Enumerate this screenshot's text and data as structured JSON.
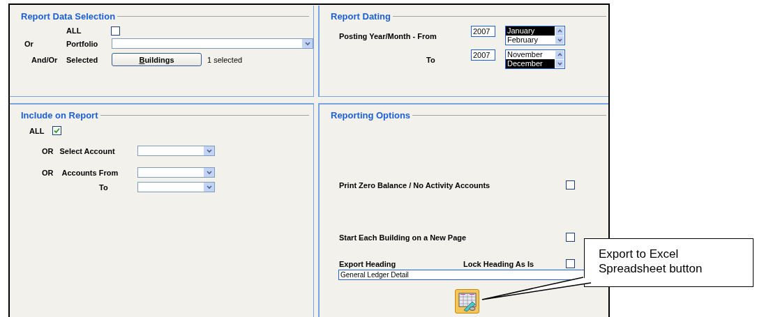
{
  "report_data_selection": {
    "title": "Report Data Selection",
    "all": {
      "label": "ALL",
      "checked": false
    },
    "portfolio": {
      "prefix": "Or",
      "label": "Portfolio"
    },
    "selected": {
      "prefix": "And/Or",
      "label": "Selected",
      "button": "**B**uildings",
      "status": "1 selected"
    }
  },
  "report_dating": {
    "title": "Report Dating",
    "rows": [
      {
        "label": "Posting Year/Month - From",
        "year": "2007",
        "months": [
          {
            "label": "January",
            "selected": true
          },
          {
            "label": "February",
            "selected": false
          }
        ]
      },
      {
        "label": "To",
        "year": "2007",
        "months": [
          {
            "label": "November",
            "selected": false
          },
          {
            "label": "December",
            "selected": true
          }
        ]
      }
    ]
  },
  "include_on_report": {
    "title": "Include on Report",
    "all": {
      "label": "ALL",
      "checked": true
    },
    "rows": [
      {
        "prefix": "OR",
        "label": "Select Account"
      },
      {
        "prefix": "OR",
        "label": "Accounts From"
      },
      {
        "prefix": "",
        "label": "To"
      }
    ]
  },
  "reporting_options": {
    "title": "Reporting Options",
    "options": [
      {
        "label": "Print Zero Balance / No Activity Accounts",
        "checked": false
      },
      {
        "label": "Start Each Building on a New Page",
        "checked": false
      }
    ],
    "export_heading": {
      "label": "Export Heading",
      "lock_label": "Lock Heading As Is",
      "lock_checked": false,
      "value": "General Ledger Detail"
    }
  },
  "callout": {
    "text": "Export to Excel Spreadsheet button"
  }
}
